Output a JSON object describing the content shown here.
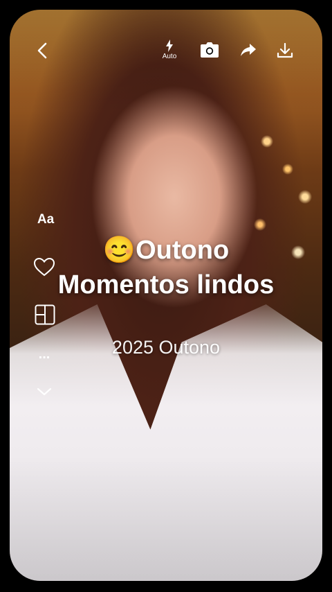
{
  "header": {
    "back_icon": "chevron-left-icon",
    "flash_icon": "flash-icon",
    "flash_label": "Auto",
    "camera_icon": "camera-icon",
    "share_icon": "share-icon",
    "download_icon": "download-icon"
  },
  "side_tools": {
    "text_label": "Aa",
    "favorite_icon": "heart-icon",
    "layout_icon": "layout-grid-icon",
    "more_label": "...",
    "collapse_icon": "chevron-down-icon"
  },
  "overlay": {
    "title_emoji": "😊",
    "title_line1": "Outono",
    "title_line2": "Momentos lindos",
    "subtitle": "2025 Outono"
  }
}
